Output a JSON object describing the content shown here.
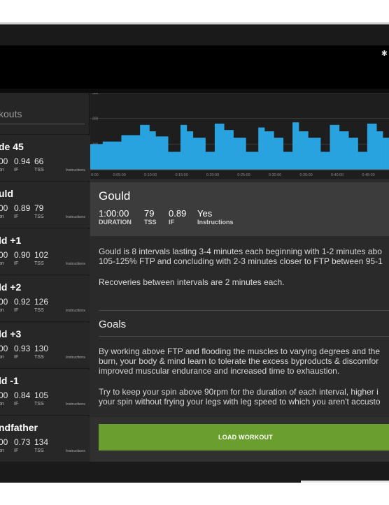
{
  "status": {
    "bluetooth_icon": "bluetooth-icon"
  },
  "sidebar": {
    "header": "kouts",
    "items": [
      {
        "name": "de 45",
        "duration": "00",
        "if": "0.94",
        "tss": "66",
        "duration_label": "on",
        "if_label": "IF",
        "tss_label": "TSS",
        "instructions": "Instructions"
      },
      {
        "name": "uld",
        "duration": "00",
        "if": "0.89",
        "tss": "79",
        "duration_label": "on",
        "if_label": "IF",
        "tss_label": "TSS",
        "instructions": "Instructions"
      },
      {
        "name": "ld +1",
        "duration": "00",
        "if": "0.90",
        "tss": "102",
        "duration_label": "on",
        "if_label": "IF",
        "tss_label": "TSS",
        "instructions": "Instructions"
      },
      {
        "name": "ld +2",
        "duration": "00",
        "if": "0.92",
        "tss": "126",
        "duration_label": "on",
        "if_label": "IF",
        "tss_label": "TSS",
        "instructions": "Instructions"
      },
      {
        "name": "ld +3",
        "duration": "00",
        "if": "0.93",
        "tss": "130",
        "duration_label": "on",
        "if_label": "IF",
        "tss_label": "TSS",
        "instructions": "Instructions"
      },
      {
        "name": "ld -1",
        "duration": "00",
        "if": "0.84",
        "tss": "105",
        "duration_label": "on",
        "if_label": "IF",
        "tss_label": "TSS",
        "instructions": "Instructions"
      },
      {
        "name": "ndfather",
        "duration": "00",
        "if": "0.73",
        "tss": "134",
        "duration_label": "on",
        "if_label": "IF",
        "tss_label": "TSS",
        "instructions": "Instructions"
      }
    ]
  },
  "chart": {
    "y_ticks": [
      "300",
      "200",
      "100"
    ],
    "x_ticks": [
      "0:00",
      "0:05:00",
      "0:10:00",
      "0:15:00",
      "0:20:00",
      "0:25:00",
      "0:30:00",
      "0:35:00",
      "0:40:00",
      "0:45:00"
    ],
    "bar_color": "#29a3e0"
  },
  "chart_data": {
    "type": "area",
    "x_unit": "minutes",
    "ylim": [
      0,
      300
    ],
    "segments": [
      {
        "start": 0,
        "end": 2,
        "y": 100
      },
      {
        "start": 2,
        "end": 5,
        "y": 110
      },
      {
        "start": 5,
        "end": 8,
        "y": 135
      },
      {
        "start": 8,
        "end": 9.5,
        "y": 175
      },
      {
        "start": 9.5,
        "end": 10.5,
        "y": 150
      },
      {
        "start": 10.5,
        "end": 12.5,
        "y": 130
      },
      {
        "start": 12.5,
        "end": 14.5,
        "y": 70
      },
      {
        "start": 14.5,
        "end": 15.5,
        "y": 175
      },
      {
        "start": 15.5,
        "end": 16.5,
        "y": 150
      },
      {
        "start": 16.5,
        "end": 18.5,
        "y": 125
      },
      {
        "start": 18.5,
        "end": 20,
        "y": 70
      },
      {
        "start": 20,
        "end": 21.5,
        "y": 180
      },
      {
        "start": 21.5,
        "end": 23,
        "y": 155
      },
      {
        "start": 23,
        "end": 25,
        "y": 125
      },
      {
        "start": 25,
        "end": 27,
        "y": 70
      },
      {
        "start": 27,
        "end": 28,
        "y": 165
      },
      {
        "start": 28,
        "end": 29.5,
        "y": 150
      },
      {
        "start": 29.5,
        "end": 31,
        "y": 125
      },
      {
        "start": 31,
        "end": 32.5,
        "y": 70
      },
      {
        "start": 32.5,
        "end": 33.5,
        "y": 185
      },
      {
        "start": 33.5,
        "end": 35,
        "y": 150
      },
      {
        "start": 35,
        "end": 37,
        "y": 125
      },
      {
        "start": 37,
        "end": 38.5,
        "y": 70
      },
      {
        "start": 38.5,
        "end": 40,
        "y": 175
      },
      {
        "start": 40,
        "end": 41.5,
        "y": 150
      },
      {
        "start": 41.5,
        "end": 43,
        "y": 125
      },
      {
        "start": 43,
        "end": 44.5,
        "y": 70
      },
      {
        "start": 44.5,
        "end": 46,
        "y": 180
      },
      {
        "start": 46,
        "end": 47,
        "y": 150
      },
      {
        "start": 47,
        "end": 48,
        "y": 125
      }
    ]
  },
  "detail": {
    "title": "Gould",
    "stats": [
      {
        "value": "1:00:00",
        "label": "DURATION"
      },
      {
        "value": "79",
        "label": "TSS"
      },
      {
        "value": "0.89",
        "label": "IF"
      },
      {
        "value": "Yes",
        "label": "Instructions"
      }
    ],
    "description_lines": [
      "Gould is 8 intervals lasting 3-4 minutes each beginning with 1-2 minutes abo",
      "105-125% FTP and concluding with 2-3 minutes closer to FTP between 95-1",
      "Recoveries between intervals are 2 minutes each."
    ],
    "goals_heading": "Goals",
    "goals_lines": [
      "By working above FTP and flooding the muscles to varying degrees and the",
      "burn, your body & mind learn to tolerate the excess byproducts & discomfor",
      "improved muscular endurance and increased time to exhaustion.",
      "Try to keep your spin above 90rpm for the duration of each interval, higher i",
      "your spin without frying your legs with leg speed to which you aren't accusto"
    ]
  },
  "actions": {
    "load_label": "LOAD WORKOUT",
    "load_color": "#6a9e2e"
  }
}
